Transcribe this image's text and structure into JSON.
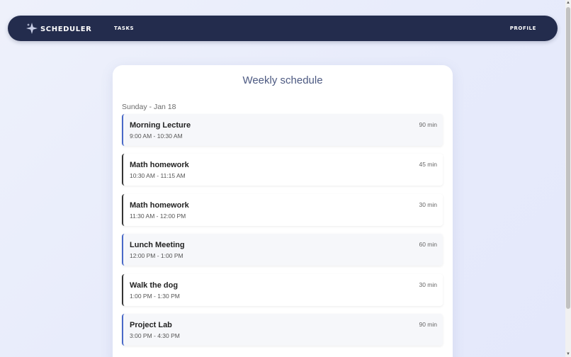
{
  "app": {
    "brand_name": "Scheduler",
    "brand_icon": "sparkle-icon",
    "nav_tasks": "Tasks",
    "nav_profile": "Profile"
  },
  "colors": {
    "navbar_bg": "#232c4d",
    "accent_blue": "#4968c7",
    "card_title": "#4d5a82",
    "page_bg": "#eceffb"
  },
  "schedule": {
    "title": "Weekly schedule",
    "day_label": "Sunday - Jan 18",
    "events": [
      {
        "name": "Morning Lecture",
        "time": "9:00 AM - 10:30 AM",
        "duration": "90 min",
        "highlight": true
      },
      {
        "name": "Math homework",
        "time": "10:30 AM - 11:15 AM",
        "duration": "45 min",
        "highlight": false
      },
      {
        "name": "Math homework",
        "time": "11:30 AM - 12:00 PM",
        "duration": "30 min",
        "highlight": false
      },
      {
        "name": "Lunch Meeting",
        "time": "12:00 PM - 1:00 PM",
        "duration": "60 min",
        "highlight": true
      },
      {
        "name": "Walk the dog",
        "time": "1:00 PM - 1:30 PM",
        "duration": "30 min",
        "highlight": false
      },
      {
        "name": "Project Lab",
        "time": "3:00 PM - 4:30 PM",
        "duration": "90 min",
        "highlight": true
      }
    ]
  },
  "scrollbar": {
    "up_arrow": "▲",
    "down_arrow": "▼"
  }
}
